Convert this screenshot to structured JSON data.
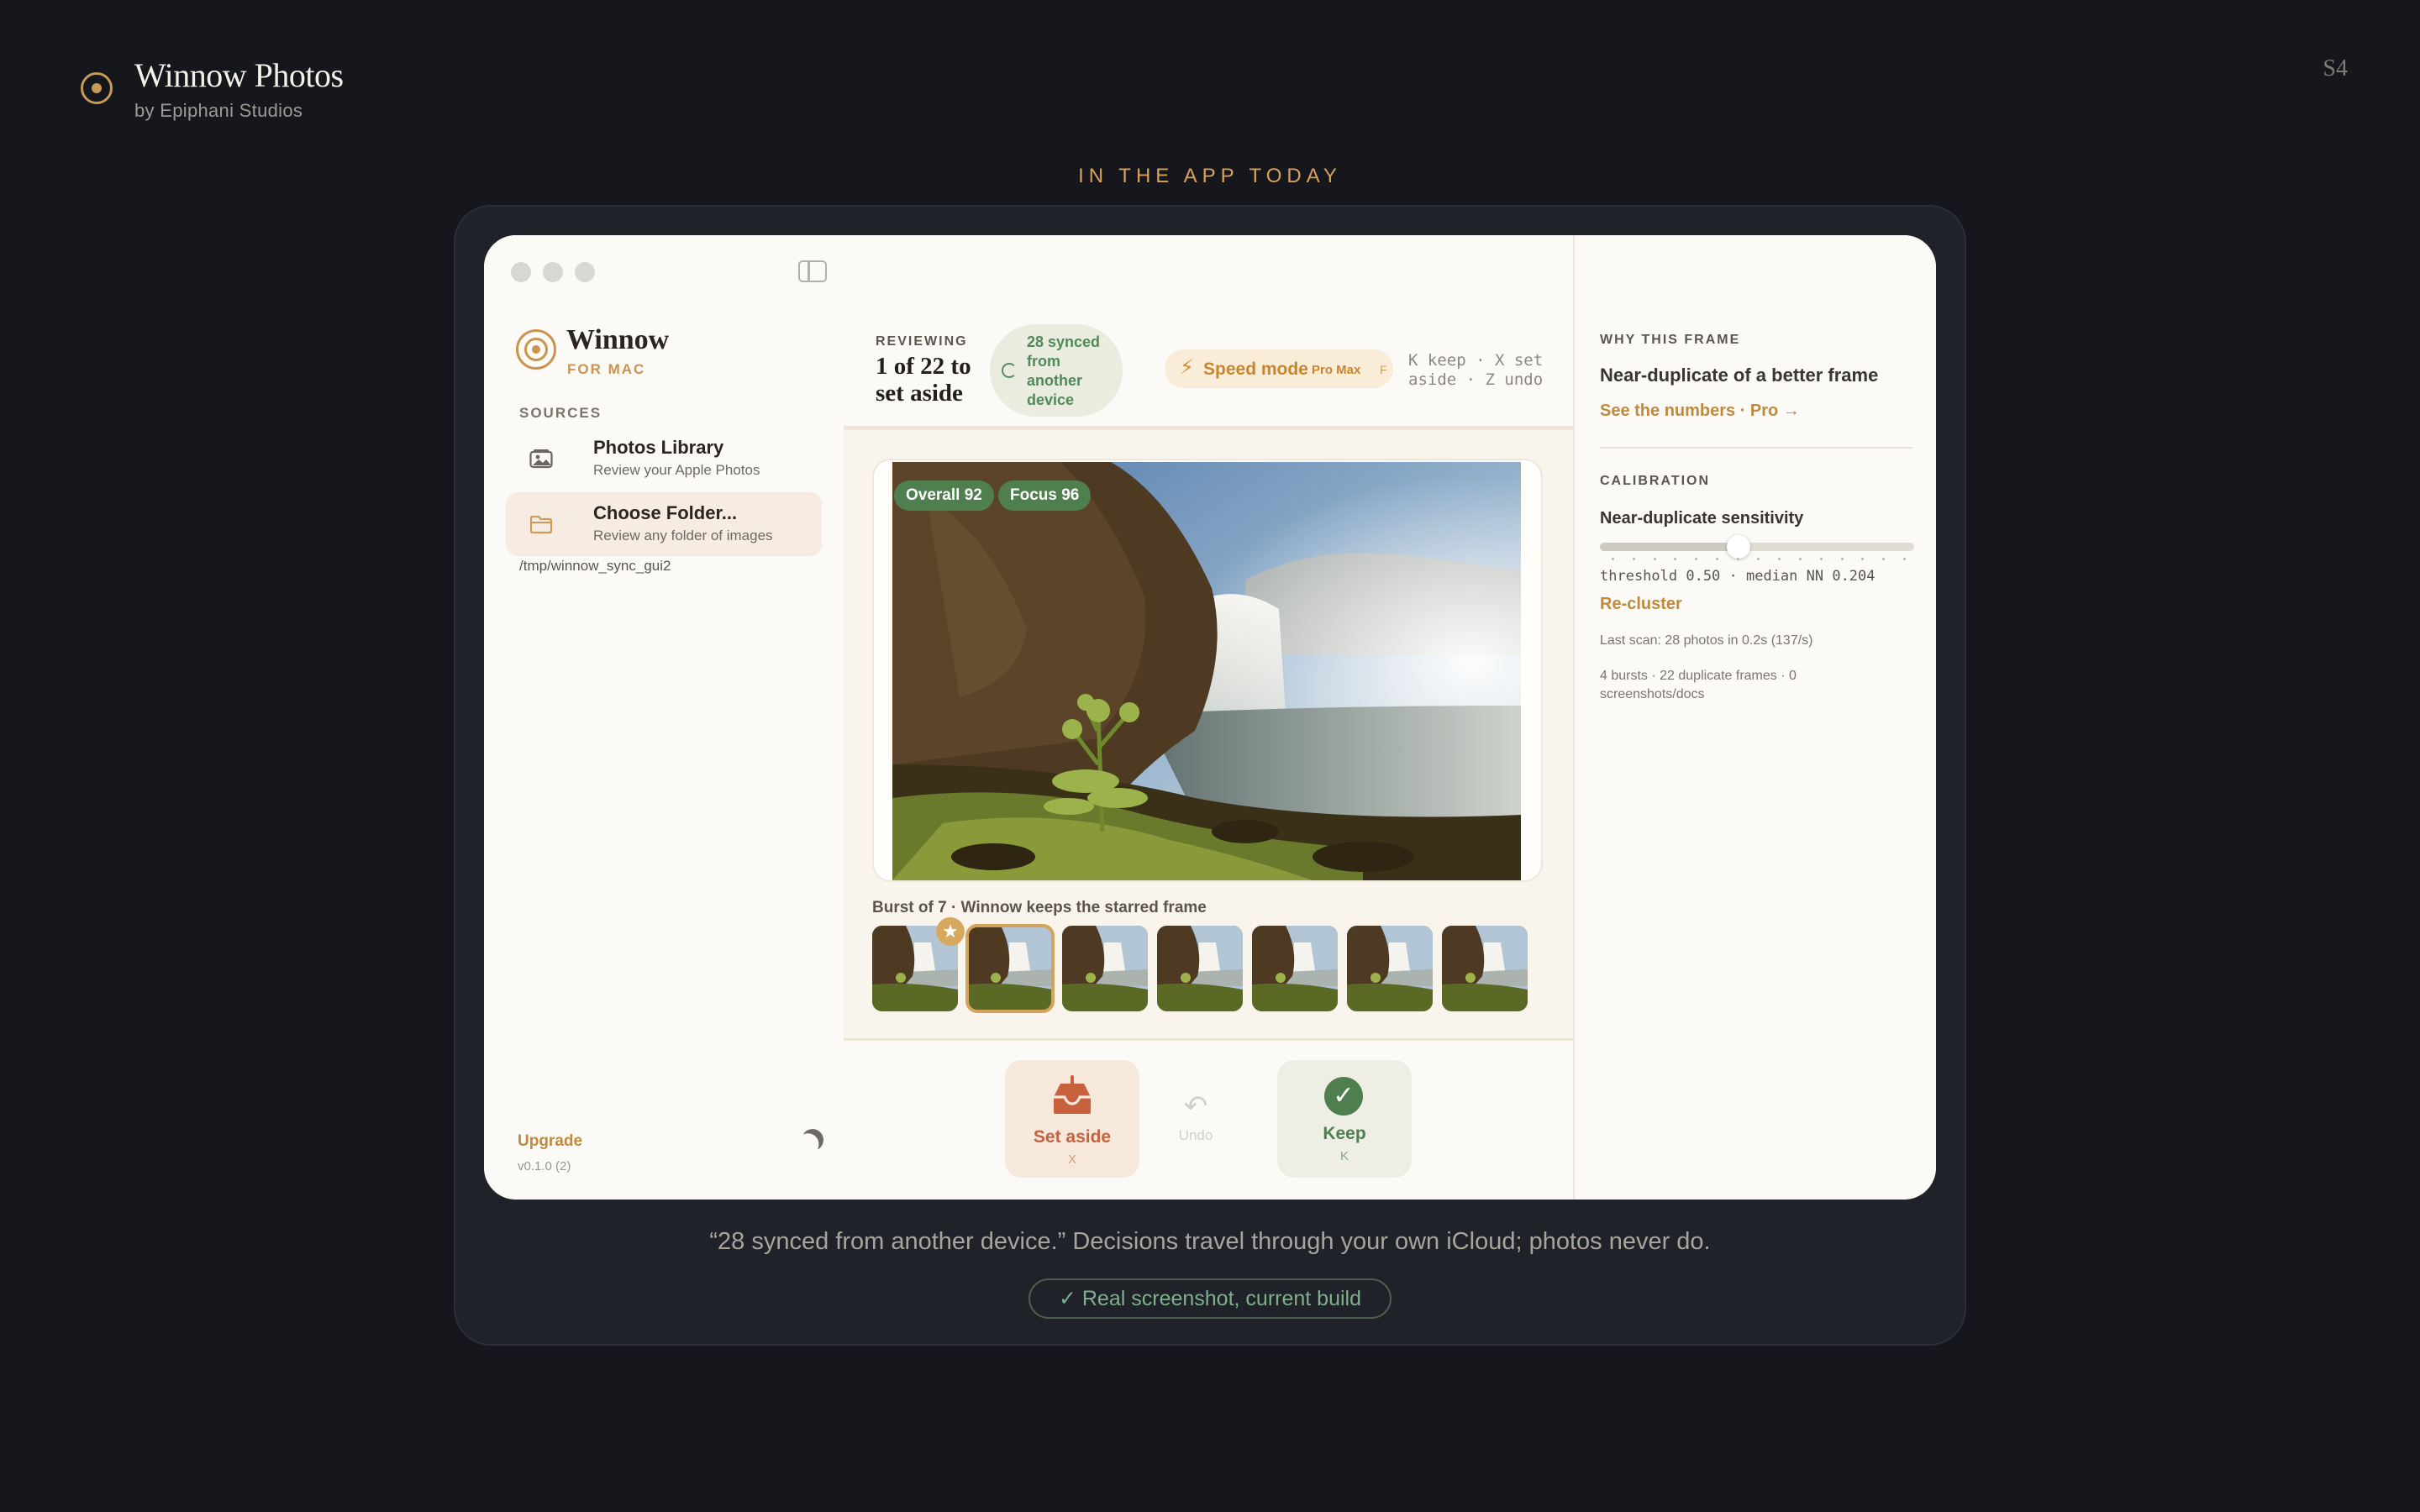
{
  "slide": {
    "brand_title_a": "Winnow",
    "brand_title_b": "Photos",
    "brand_sub": "by Epiphani Studios",
    "slide_number": "S4",
    "eyebrow": "IN THE APP TODAY",
    "caption": "“28 synced from another device.” Decisions travel through your own iCloud; photos never do.",
    "verified": "✓ Real screenshot, current build"
  },
  "sidebar": {
    "app_name": "Winnow",
    "app_sub": "FOR MAC",
    "section_label": "SOURCES",
    "sources": [
      {
        "title": "Photos Library",
        "desc": "Review your Apple Photos"
      },
      {
        "title": "Choose Folder...",
        "desc": "Review any folder of images"
      }
    ],
    "folder_path": "/tmp/winnow_sync_gui2",
    "upgrade": "Upgrade",
    "version": "v0.1.0 (2)"
  },
  "review": {
    "label": "REVIEWING",
    "count": "1 of 22 to set aside",
    "sync": "28 synced from another device",
    "speed_label": "Speed mode",
    "speed_badge": "Pro Max",
    "speed_key": "F",
    "shortcuts": "K keep · X set aside · Z undo",
    "score_overall": "Overall 92",
    "score_focus": "Focus 96",
    "burst_label": "Burst of 7 · Winnow keeps the starred frame",
    "burst_count": 7,
    "starred_index": 0,
    "selected_index": 1
  },
  "actions": {
    "set_aside": "Set aside",
    "set_aside_key": "X",
    "undo": "Undo",
    "keep": "Keep",
    "keep_key": "K"
  },
  "panel": {
    "why_label": "WHY THIS FRAME",
    "why_text": "Near-duplicate of a better frame",
    "why_link": "See the numbers · Pro →",
    "calib_label": "CALIBRATION",
    "calib_title": "Near-duplicate sensitivity",
    "threshold_value": 0.5,
    "threshold_text": "threshold 0.50 · median NN 0.204",
    "recluster": "Re-cluster",
    "last_scan": "Last scan: 28 photos in 0.2s (137/s)",
    "summary": "4 bursts · 22 duplicate frames · 0 screenshots/docs"
  },
  "colors": {
    "accent": "#c9944f",
    "keep_green": "#4f7e4f",
    "aside_coral": "#c8613e"
  }
}
